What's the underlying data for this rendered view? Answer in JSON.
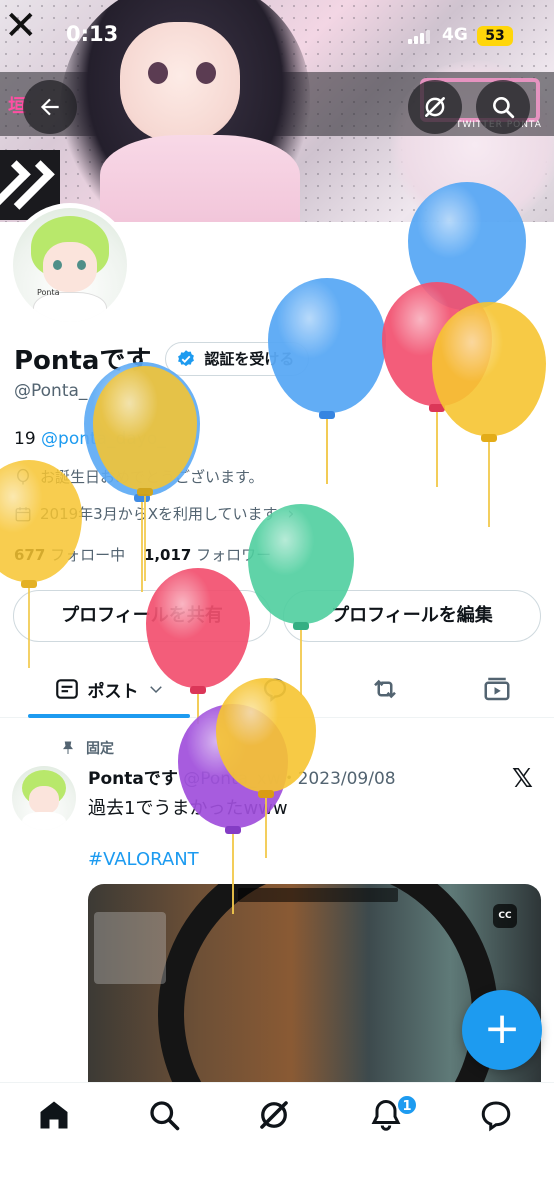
{
  "status_bar": {
    "time": "0:13",
    "network": "4G",
    "battery": "53"
  },
  "banner": {
    "deco_text": "垣",
    "side_text": "TWITTER PONTA"
  },
  "profile": {
    "name": "Pontaです",
    "verify_button": "認証を受ける",
    "handle": "@Ponta_",
    "bio_prefix": "19 ",
    "bio_mention": "@ponta_dayo_",
    "birthday": "お誕生日おめでとうございます。",
    "joined": "2019年3月からXを利用しています",
    "following_count": "677",
    "following_label": "フォロー中",
    "followers_count": "1,017",
    "followers_label": "フォロワー",
    "share_button": "プロフィールを共有",
    "edit_button": "プロフィールを編集",
    "avatar_tag": "Ponta"
  },
  "tabs": {
    "active_label": "ポスト"
  },
  "post": {
    "pinned_label": "固定",
    "author": "Pontaです",
    "meta": "@Ponta_xw・2023/09/08",
    "text": "過去1でうまかったwww",
    "hashtag": "#VALORANT",
    "cc_label": "CC"
  },
  "nav": {
    "notification_count": "1"
  },
  "colors": {
    "accent": "#1d9bf0",
    "text": "#0f1419",
    "muted": "#536471"
  },
  "balloons": [
    {
      "color": "#5aa9f5",
      "knot": "#2c7fe0"
    },
    {
      "color": "#f2506f",
      "knot": "#d8254a"
    },
    {
      "color": "#f7c531",
      "knot": "#e0a400"
    },
    {
      "color": "#4fcf9f",
      "knot": "#1fa776"
    },
    {
      "color": "#a04fdc",
      "knot": "#7a2cc0"
    }
  ]
}
